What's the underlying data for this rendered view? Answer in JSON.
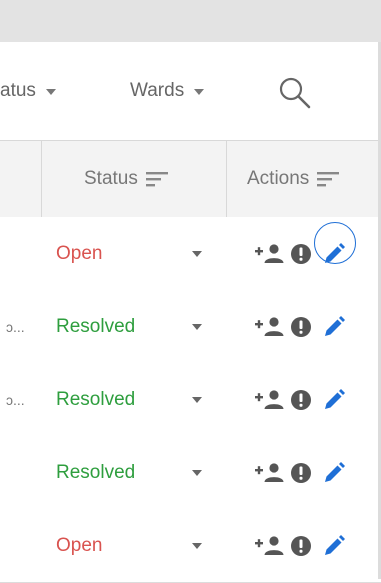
{
  "filters": {
    "status_label": "atus",
    "wards_label": "Wards"
  },
  "table": {
    "columns": {
      "status": "Status",
      "actions": "Actions"
    },
    "rows": [
      {
        "trunc": "",
        "status": "Open",
        "status_kind": "open"
      },
      {
        "trunc": "ɔ...",
        "status": "Resolved",
        "status_kind": "resolved"
      },
      {
        "trunc": "ɔ...",
        "status": "Resolved",
        "status_kind": "resolved"
      },
      {
        "trunc": "",
        "status": "Resolved",
        "status_kind": "resolved"
      },
      {
        "trunc": "",
        "status": "Open",
        "status_kind": "open"
      }
    ]
  },
  "icons": {
    "search": "search-icon",
    "sort": "sort-icon",
    "add_user": "add-user-icon",
    "alert": "alert-icon",
    "edit": "pencil-icon"
  },
  "colors": {
    "open": "#d9534f",
    "resolved": "#2e9e3e",
    "accent": "#1f6fd6"
  }
}
